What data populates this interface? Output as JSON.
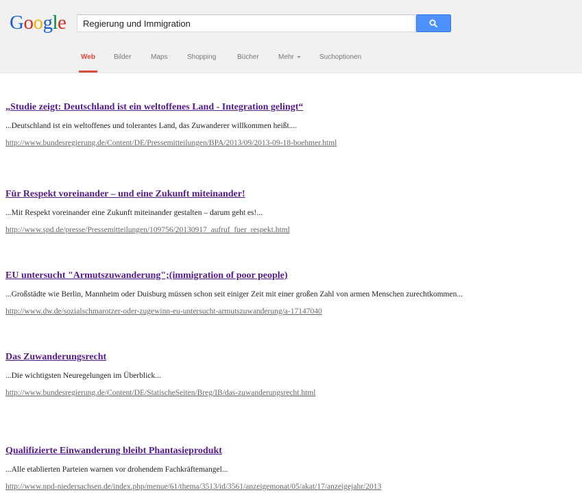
{
  "logo": {
    "text": "Google",
    "letters": [
      {
        "ch": "G",
        "color": "#1a5fd6"
      },
      {
        "ch": "o",
        "color": "#d62d20"
      },
      {
        "ch": "o",
        "color": "#f0b400"
      },
      {
        "ch": "g",
        "color": "#1a5fd6"
      },
      {
        "ch": "l",
        "color": "#008744"
      },
      {
        "ch": "e",
        "color": "#d62d20"
      }
    ]
  },
  "search": {
    "value": "Regierung und Immigration",
    "button_icon": "search-icon"
  },
  "nav": {
    "items": [
      {
        "label": "Web",
        "active": true
      },
      {
        "label": "Bilder",
        "active": false
      },
      {
        "label": "Maps",
        "active": false
      },
      {
        "label": "Shopping",
        "active": false
      },
      {
        "label": "Bücher",
        "active": false
      },
      {
        "label": "Mehr",
        "active": false,
        "icon": "caret-down-icon"
      },
      {
        "label": "Suchoptionen",
        "active": false
      }
    ]
  },
  "results": [
    {
      "title": "„Studie zeigt: Deutschland ist ein weltoffenes Land - Integration gelingt“",
      "snippet": "...Deutschland ist ein weltoffenes und tolerantes Land, das Zuwanderer willkommen heißt....",
      "url": "http://www.bundesregierung.de/Content/DE/Pressemitteilungen/BPA/2013/09/2013-09-18-boehmer.html"
    },
    {
      "title": "Für Respekt voreinander – und eine Zukunft miteinander!",
      "snippet": "...Mit Respekt voreinander eine Zukunft miteinander gestalten – darum geht es!...",
      "url": "http://www.spd.de/presse/Pressemitteilungen/109756/20130917_aufruf_fuer_respekt.html"
    },
    {
      "title": "EU untersucht \"Armutszuwanderung\";(immigration of poor people)",
      "snippet": "...Großstädte wie Berlin, Mannheim oder Duisburg müssen schon seit einiger Zeit mit einer großen Zahl von armen Menschen zurechtkommen...",
      "url": "http://www.dw.de/sozialschmarotzer-oder-zugewinn-eu-untersucht-armutszuwanderung/a-17147040"
    },
    {
      "title": "Das Zuwanderungsrecht",
      "snippet": "...Die wichtigsten Neuregelungen im Überblick...",
      "url": "http://www.bundesregierung.de/Content/DE/StatischeSeiten/Breg/IB/das-zuwanderungsrecht.html"
    },
    {
      "title": "Qualifizierte Einwanderung bleibt Phantasieprodukt",
      "snippet": "...Alle etablierten Parteien warnen vor drohendem Fachkräftemangel...",
      "url": "http://www.npd-niedersachsen.de/index.php/menue/61/thema/3513/id/3561/anzeigemonat/05/akat/17/anzeigejahr/2013"
    }
  ],
  "colors": {
    "accent_active_tab": "#dd4b39",
    "link_visited": "#551a8b",
    "search_button": "#4d90fe"
  }
}
